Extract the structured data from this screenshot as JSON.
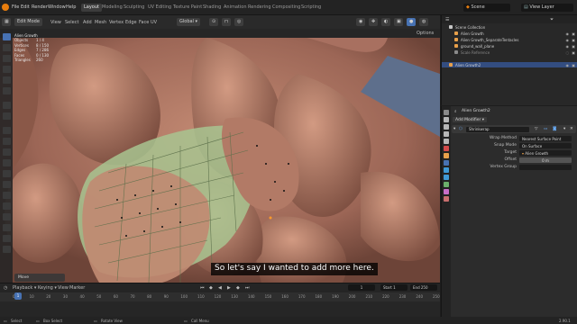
{
  "topbar": {
    "menus": [
      "File",
      "Edit",
      "Render",
      "Window",
      "Help"
    ],
    "workspaces": [
      "Layout",
      "Modeling",
      "Sculpting",
      "UV Editing",
      "Texture Paint",
      "Shading",
      "Animation",
      "Rendering",
      "Compositing",
      "Scripting"
    ],
    "active_workspace": "Layout",
    "scene": "Scene",
    "view_layer": "View Layer"
  },
  "viewport_header": {
    "mode": "Edit Mode",
    "menus": [
      "View",
      "Select",
      "Add",
      "Mesh",
      "Vertex",
      "Edge",
      "Face",
      "UV"
    ],
    "orientation": "Global",
    "options": "Options"
  },
  "stats": [
    {
      "label": "Objects",
      "value": "1 / 4"
    },
    {
      "label": "Vertices",
      "value": "8 / 150"
    },
    {
      "label": "Edges",
      "value": "7 / 286"
    },
    {
      "label": "Faces",
      "value": "0 / 130"
    },
    {
      "label": "Triangles",
      "value": "260"
    }
  ],
  "stats_title": "Alien Growth",
  "subtitle": "So let's say I wanted to add more here.",
  "move_panel": "Move",
  "timeline": {
    "menus": [
      "Playback",
      "Keying",
      "View",
      "Marker"
    ],
    "current_frame": "1",
    "start_label": "Start",
    "start": "1",
    "end_label": "End",
    "end": "250",
    "ticks": [
      "0",
      "10",
      "20",
      "30",
      "40",
      "50",
      "60",
      "70",
      "80",
      "90",
      "100",
      "110",
      "120",
      "130",
      "140",
      "150",
      "160",
      "170",
      "180",
      "190",
      "200",
      "210",
      "220",
      "230",
      "240",
      "250"
    ]
  },
  "statusbar": {
    "select": "Select",
    "box_select": "Box Select",
    "rotate_view": "Rotate View",
    "call_menu": "Call Menu",
    "version": "2.90.1"
  },
  "outliner": {
    "rows": [
      {
        "label": "Scene Collection",
        "color": "#c8c8c8",
        "selected": false
      },
      {
        "label": "Alien Growth",
        "color": "#e8a04a",
        "selected": false
      },
      {
        "label": "Alien Growth_SeparateTentacles",
        "color": "#e8a04a",
        "selected": false
      },
      {
        "label": "ground_wall_plane",
        "color": "#e8a04a",
        "selected": false
      },
      {
        "label": "Scale Reference",
        "color": "#8a8a8a",
        "selected": false
      },
      {
        "label": "Alien Growth2",
        "color": "#e8a04a",
        "selected": true
      }
    ]
  },
  "properties": {
    "object_name": "Alien Growth2",
    "add_modifier": "Add Modifier",
    "modifier_name": "Shrinkwrap",
    "fields": [
      {
        "label": "Wrap Method",
        "value": "Nearest Surface Point"
      },
      {
        "label": "Snap Mode",
        "value": "On Surface"
      },
      {
        "label": "Target",
        "value": "Alien Growth"
      },
      {
        "label": "Offset",
        "value": "0 m"
      },
      {
        "label": "Vertex Group",
        "value": ""
      }
    ]
  },
  "colors": {
    "accent": "#4772b3",
    "mesh": "#b07862",
    "wire_overlay": "#a8c490",
    "background": "#5a6c89"
  }
}
